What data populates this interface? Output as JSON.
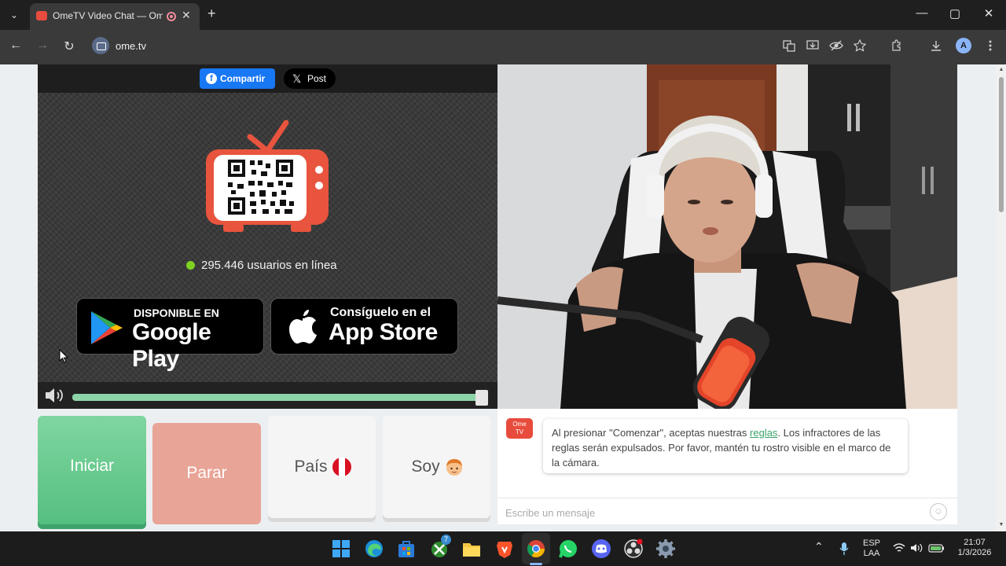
{
  "browser": {
    "tab_title": "OmeTV Video Chat — Ome",
    "url": "ome.tv",
    "new_tab": "+",
    "tab_close": "✕",
    "tabs_menu": "⌄",
    "win_min": "—",
    "win_max": "▢",
    "win_close": "✕",
    "back": "←",
    "forward": "→",
    "reload": "↻",
    "profile_initial": "A"
  },
  "share": {
    "facebook_label": "Compartir",
    "x_label": "Post"
  },
  "promo": {
    "online_count": "295.446 usuarios en línea",
    "google_small": "DISPONIBLE EN",
    "google_big": "Google Play",
    "apple_small": "Consíguelo en el",
    "apple_big": "App Store"
  },
  "audio": {
    "volume_level": 1.0
  },
  "controls": {
    "start_label": "Iniciar",
    "stop_label": "Parar",
    "country_label": "País",
    "gender_label": "Soy"
  },
  "chat": {
    "logo_text_top": "Ome",
    "logo_text_bottom": "TV",
    "message_before": "Al presionar \"Comenzar\", aceptas nuestras ",
    "message_link": "reglas",
    "message_after": ". Los infractores de las reglas serán expulsados. Por favor, mantén tu rostro visible en el marco de la cámara.",
    "input_placeholder": "Escribe un mensaje"
  },
  "taskbar": {
    "language_top": "ESP",
    "language_bottom": "LAA",
    "time": "21:07",
    "date": "1/3/2026",
    "xbox_badge": "7"
  },
  "colors": {
    "accent_green": "#55bf80",
    "stop_salmon": "#e8a497",
    "ome_red": "#e84c3d",
    "facebook_blue": "#1877f2"
  }
}
